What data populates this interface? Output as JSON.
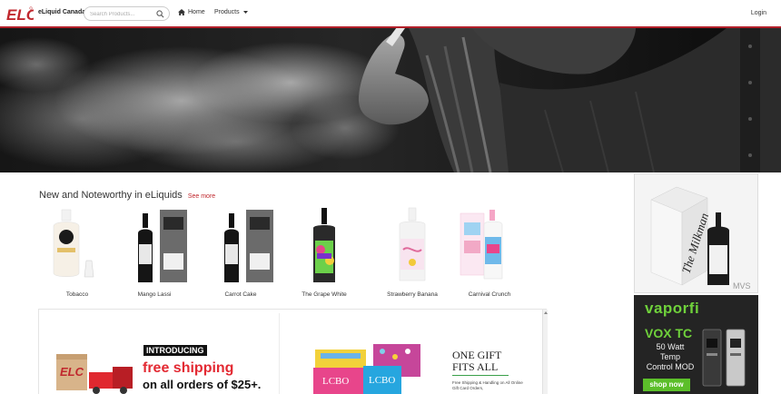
{
  "header": {
    "logo_text": "ELC",
    "brand": "eLiquid Canada",
    "search_placeholder": "Search Products...",
    "home_label": "Home",
    "products_label": "Products",
    "login_label": "Login"
  },
  "section": {
    "title": "New and Noteworthy in eLiquids",
    "see_more": "See more"
  },
  "products": [
    {
      "name": "Tobacco"
    },
    {
      "name": "Mango Lassi"
    },
    {
      "name": "Carrot Cake"
    },
    {
      "name": "The Grape White"
    },
    {
      "name": "Strawberry Banana"
    },
    {
      "name": "Carnival Crunch"
    }
  ],
  "promo_shipping": {
    "intro": "INTRODUCING",
    "headline": "free shipping",
    "subline": "on all orders of $25+."
  },
  "promo_gift": {
    "title": "ONE GIFT FITS ALL",
    "note": "Free Shipping & Handling on All Online Gift Card Orders,",
    "card_label_1": "LCBO",
    "card_label_2": "LCBO"
  },
  "ad_milkman": {
    "brand": "The Milkman",
    "tag": "MVS"
  },
  "ad_vaporfi": {
    "logo": "vaporfi",
    "model": "VOX TC",
    "line1": "50 Watt",
    "line2": "Temp",
    "line3": "Control MOD",
    "button": "shop now"
  },
  "colors": {
    "accent_red": "#c0272d",
    "vapor_green": "#6fd13b"
  }
}
